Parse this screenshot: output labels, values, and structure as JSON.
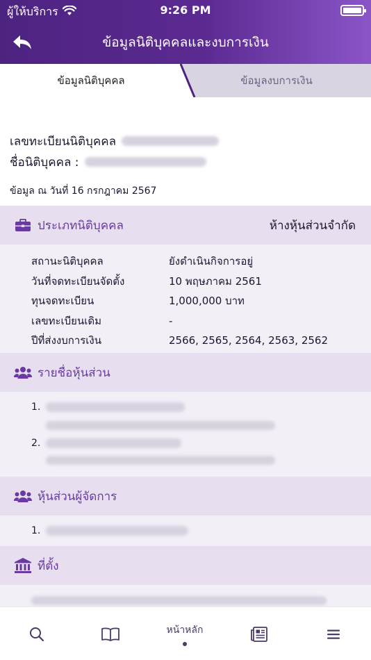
{
  "status_bar": {
    "carrier": "ผู้ให้บริการ",
    "time": "9:26 PM",
    "battery_level": 1.0
  },
  "header": {
    "title": "ข้อมูลนิติบุคคลและงบการเงิน"
  },
  "tabs": [
    {
      "label": "ข้อมูลนิติบุคคล",
      "active": true
    },
    {
      "label": "ข้อมูลงบการเงิน",
      "active": false
    }
  ],
  "company": {
    "reg_label": "เลขทะเบียนนิติบุคคล",
    "name_label": "ชื่อนิติบุคคล :",
    "as_of": "ข้อมูล ณ วันที่ 16 กรกฎาคม 2567"
  },
  "type_section": {
    "title": "ประเภทนิติบุคคล",
    "value": "ห้างหุ้นส่วนจำกัด"
  },
  "details": [
    {
      "label": "สถานะนิติบุคคล",
      "value": "ยังดำเนินกิจการอยู่"
    },
    {
      "label": "วันที่จดทะเบียนจัดตั้ง",
      "value": "10 พฤษภาคม 2561"
    },
    {
      "label": "ทุนจดทะเบียน",
      "value": "1,000,000 บาท"
    },
    {
      "label": "เลขทะเบียนเดิม",
      "value": "-"
    },
    {
      "label": "ปีที่ส่งงบการเงิน",
      "value": "2566, 2565, 2564, 2563, 2562"
    }
  ],
  "partners_section": {
    "title": "รายชื่อหุ้นส่วน",
    "items": [
      "1.",
      "2."
    ]
  },
  "managing_section": {
    "title": "หุ้นส่วนผู้จัดการ",
    "items": [
      "1."
    ]
  },
  "location_section": {
    "title": "ที่ตั้ง"
  },
  "tabbar": {
    "items": [
      {
        "icon": "search-icon",
        "label": ""
      },
      {
        "icon": "book-icon",
        "label": ""
      },
      {
        "icon": "home",
        "label": "หน้าหลัก",
        "active": true
      },
      {
        "icon": "newspaper-icon",
        "label": ""
      },
      {
        "icon": "menu-icon",
        "label": ""
      }
    ]
  },
  "colors": {
    "header_start": "#4d2380",
    "header_end": "#8b55c8",
    "accent": "#6a3aa3",
    "section_bg": "#e7dff0",
    "body_bg": "#f3eff7"
  }
}
